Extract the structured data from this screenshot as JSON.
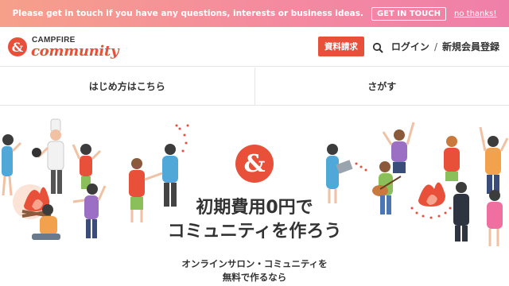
{
  "banner": {
    "text": "Please get in touch if you have any questions, interests or business ideas.",
    "button": "GET IN TOUCH",
    "dismiss": "no thanks!"
  },
  "header": {
    "logo_top": "CAMPFIRE",
    "logo_bottom": "community",
    "doc_button": "資料請求",
    "search_icon": "search-icon",
    "login": "ログイン",
    "separator": "/",
    "signup": "新規会員登録"
  },
  "tabs": [
    {
      "label": "はじめ方はこちら"
    },
    {
      "label": "さがす"
    }
  ],
  "hero": {
    "title_line1": "初期費用0円で",
    "title_line2": "コミュニティを作ろう",
    "sub_line1": "オンラインサロン・コミュニティを",
    "sub_line2": "無料で作るなら"
  },
  "colors": {
    "brand": "#e8503a",
    "banner_start": "#f6a08a",
    "banner_end": "#ef7fa9"
  }
}
